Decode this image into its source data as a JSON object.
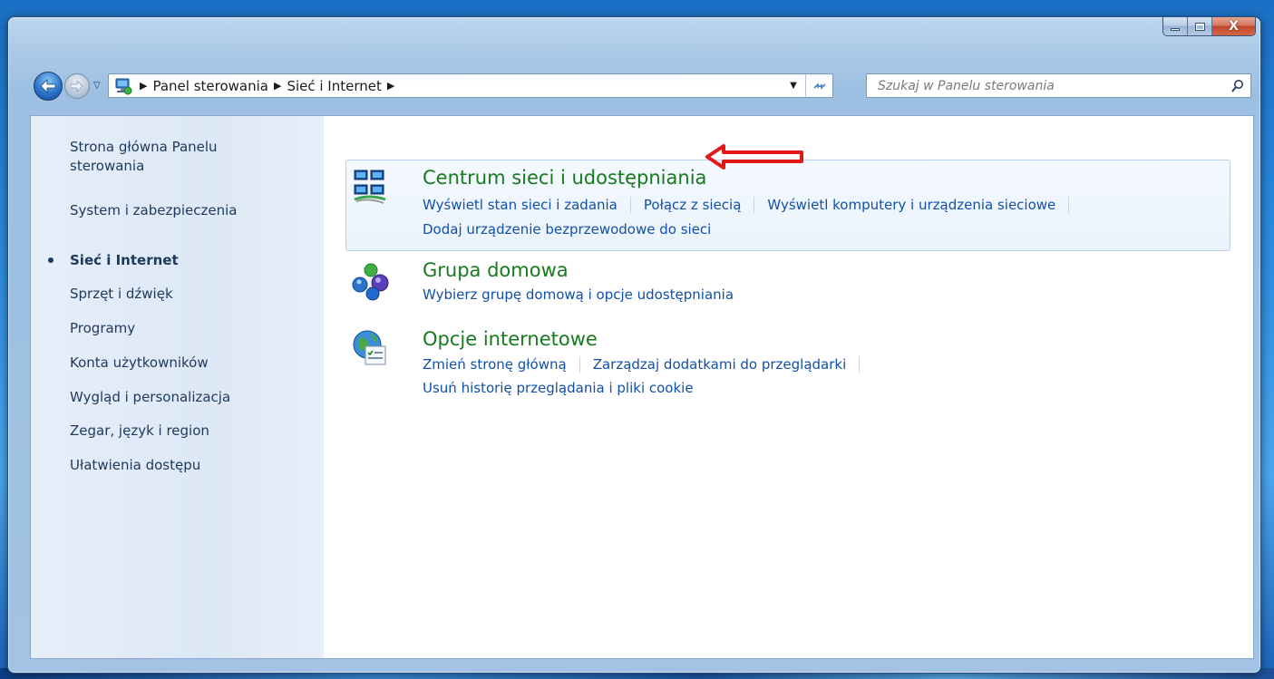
{
  "window": {
    "caption_buttons": {
      "minimize_icon": "minimize-icon",
      "maximize_icon": "maximize-icon",
      "close_label": "X"
    }
  },
  "navbar": {
    "breadcrumbs": [
      "Panel sterowania",
      "Sieć i Internet"
    ],
    "search_placeholder": "Szukaj w Panelu sterowania"
  },
  "sidebar": {
    "items": [
      {
        "label_line1": "Strona główna Panelu",
        "label_line2": "sterowania"
      },
      {
        "label": "System i zabezpieczenia"
      },
      {
        "label": "Sieć i Internet",
        "current": true
      },
      {
        "label": "Sprzęt i dźwięk"
      },
      {
        "label": "Programy"
      },
      {
        "label": "Konta użytkowników"
      },
      {
        "label": "Wygląd i personalizacja"
      },
      {
        "label": "Zegar, język i region"
      },
      {
        "label": "Ułatwienia dostępu"
      }
    ]
  },
  "categories": [
    {
      "title": "Centrum sieci i udostępniania",
      "icon": "network-center-icon",
      "tasks_line1": [
        "Wyświetl stan sieci i zadania",
        "Połącz z siecią",
        "Wyświetl komputery i urządzenia sieciowe"
      ],
      "tasks_line2": [
        "Dodaj urządzenie bezprzewodowe do sieci"
      ]
    },
    {
      "title": "Grupa domowa",
      "icon": "homegroup-icon",
      "tasks_line1": [
        "Wybierz grupę domową i opcje udostępniania"
      ]
    },
    {
      "title": "Opcje internetowe",
      "icon": "internet-options-icon",
      "tasks_line1": [
        "Zmień stronę główną",
        "Zarządzaj dodatkami do przeglądarki"
      ],
      "tasks_line2": [
        "Usuń historię przeglądania i pliki cookie"
      ]
    }
  ],
  "colors": {
    "category_title": "#177a1f",
    "task_link": "#1250a8",
    "sidebar_text": "#1e395b",
    "annotation_arrow": "#e01818"
  }
}
